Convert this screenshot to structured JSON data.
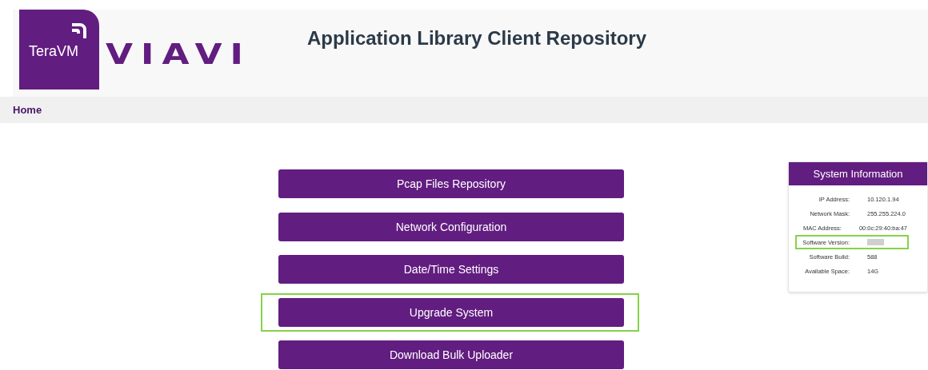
{
  "header": {
    "logo_badge": "TeraVM",
    "logo_wordmark": "VIAVI",
    "title": "Application Library Client Repository"
  },
  "nav": {
    "items": [
      {
        "label": "Home"
      }
    ]
  },
  "menu_buttons": [
    {
      "label": "Pcap Files Repository",
      "highlighted": false
    },
    {
      "label": "Network Configuration",
      "highlighted": false
    },
    {
      "label": "Date/Time Settings",
      "highlighted": false
    },
    {
      "label": "Upgrade System",
      "highlighted": true
    },
    {
      "label": "Download Bulk Uploader",
      "highlighted": false
    }
  ],
  "system_information": {
    "title": "System Information",
    "rows": [
      {
        "label": "IP Address:",
        "value": "10.120.1.94",
        "highlighted": false,
        "redacted": false
      },
      {
        "label": "Network Mask:",
        "value": "255.255.224.0",
        "highlighted": false,
        "redacted": false
      },
      {
        "label": "MAC Address:",
        "value": "00:0c:29:40:ba:47",
        "highlighted": false,
        "redacted": false
      },
      {
        "label": "Software Version:",
        "highlighted": true,
        "redacted": true
      },
      {
        "label": "Software Build:",
        "value": "588",
        "highlighted": false,
        "redacted": false
      },
      {
        "label": "Available Space:",
        "value": "14G",
        "highlighted": false,
        "redacted": false
      }
    ]
  }
}
